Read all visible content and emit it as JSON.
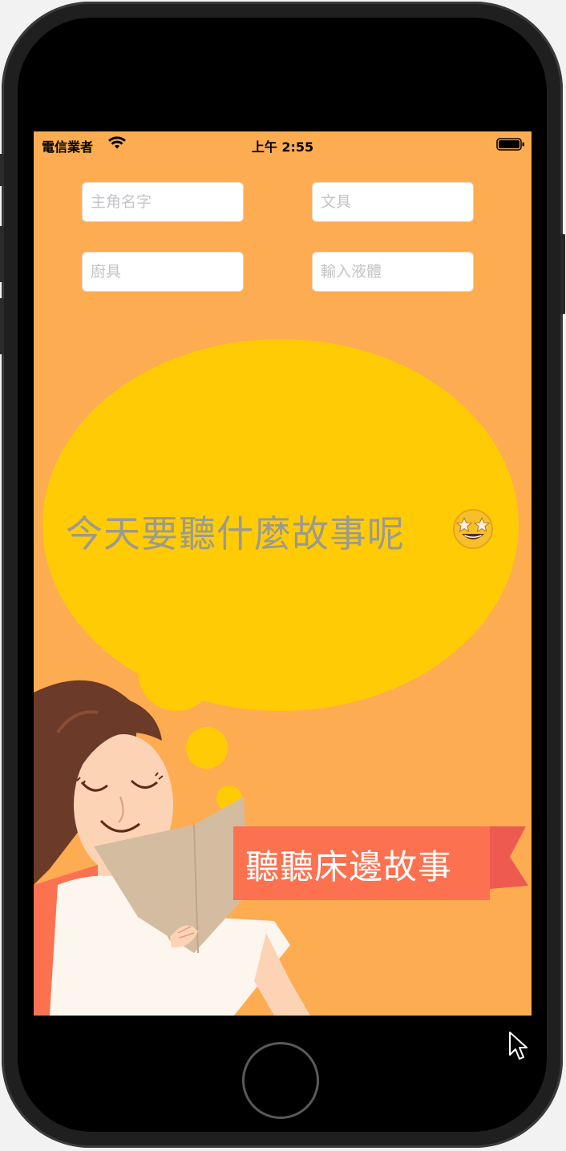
{
  "status_bar": {
    "carrier": "電信業者",
    "time": "上午 2:55"
  },
  "form": {
    "protagonist_placeholder": "主角名字",
    "stationery_placeholder": "文具",
    "kitchenware_placeholder": "廚具",
    "liquid_placeholder": "輸入液體"
  },
  "bubble": {
    "question": "今天要聽什麼故事呢"
  },
  "ribbon": {
    "label": "聽聽床邊故事"
  },
  "icons": {
    "wifi": "wifi-icon",
    "battery": "battery-icon",
    "emoji": "star-struck-emoji-icon",
    "cursor": "mouse-pointer-icon"
  },
  "colors": {
    "background": "#fdac52",
    "bubble": "#ffcb05",
    "ribbon": "#fc7150",
    "question_text": "#9c9a8e"
  }
}
